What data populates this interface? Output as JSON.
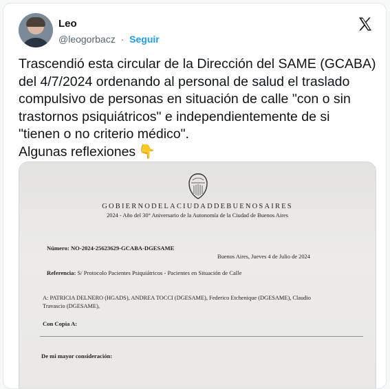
{
  "author": {
    "name": "Leo",
    "handle": "@leogorbacz",
    "separator": "·",
    "follow_label": "Seguir"
  },
  "tweet": {
    "lines": [
      "Trascendió esta circular de la Dirección del SAME (GCABA)",
      "del 4/7/2024 ordenando al personal de salud el traslado",
      "compulsivo de personas en situación de calle \"con o sin",
      "trastornos psiquiátricos\" e independientemente de si",
      "\"tienen o no criterio médico\".",
      "Algunas reflexiones"
    ],
    "emoji": "👇"
  },
  "document": {
    "header": "GOBIERNODELACIUDADDEBUENOSAIRES",
    "subtitle": "2024 - Año del 30° Aniversario de la Autonomía de la Ciudad de Buenos Aires",
    "numero_label": "Número:",
    "numero_value": "NO-2024-25623629-GCABA-DGESAME",
    "date": "Buenos Aires, Jueves 4 de Julio de 2024",
    "referencia_label": "Referencia:",
    "referencia_value": "S/ Protocolo Pacientes Psiquiátricos - Pacientes en Situación de Calle",
    "a_line1": "A: PATRICIA DELNERO (HGADS), ANDREA TOCCI (DGESAME), Federico Etchenique (DGESAME), Claudio",
    "a_line2": "Travascio (DGESAME),",
    "copia_label": "Con Copia A:",
    "consideracion": "De mi mayor consideración:"
  },
  "colors": {
    "accent": "#1d9bf0",
    "text": "#0f1419",
    "secondary": "#536471"
  },
  "icons": {
    "brand": "x-logo-icon",
    "emoji": "pointing-down-emoji"
  }
}
